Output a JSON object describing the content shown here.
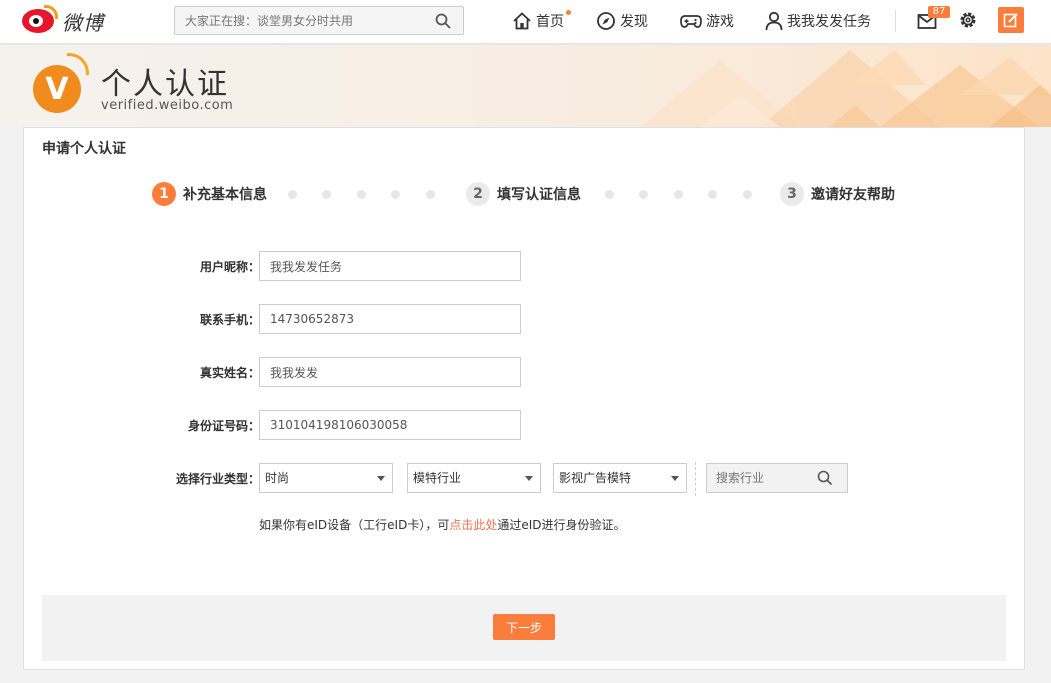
{
  "topbar": {
    "logo_text": "微博",
    "search_placeholder": "大家正在搜：谈堂男女分时共用",
    "nav": {
      "home": "首页",
      "discover": "发现",
      "games": "游戏",
      "username": "我我发发任务"
    },
    "mail_count": "87"
  },
  "banner": {
    "title": "个人认证",
    "subtitle": "verified.weibo.com",
    "v_letter": "V"
  },
  "form": {
    "title": "申请个人认证",
    "steps": [
      {
        "num": "1",
        "label": "补充基本信息"
      },
      {
        "num": "2",
        "label": "填写认证信息"
      },
      {
        "num": "3",
        "label": "邀请好友帮助"
      }
    ],
    "fields": {
      "nickname_label": "用户昵称：",
      "nickname_value": "我我发发任务",
      "phone_label": "联系手机：",
      "phone_value": "14730652873",
      "realname_label": "真实姓名：",
      "realname_value": "我我发发",
      "idcard_label": "身份证号码：",
      "idcard_value": "310104198106030058",
      "industry_label": "选择行业类型："
    },
    "industry": {
      "level1": "时尚",
      "level2": "模特行业",
      "level3": "影视广告模特",
      "search_placeholder": "搜索行业"
    },
    "hint": {
      "prefix": "如果你有eID设备（工行eID卡），可",
      "link": "点击此处",
      "suffix": "通过eID进行身份验证。"
    },
    "next_button": "下一步"
  },
  "colors": {
    "accent": "#fa7d3c",
    "link": "#eb7350"
  }
}
